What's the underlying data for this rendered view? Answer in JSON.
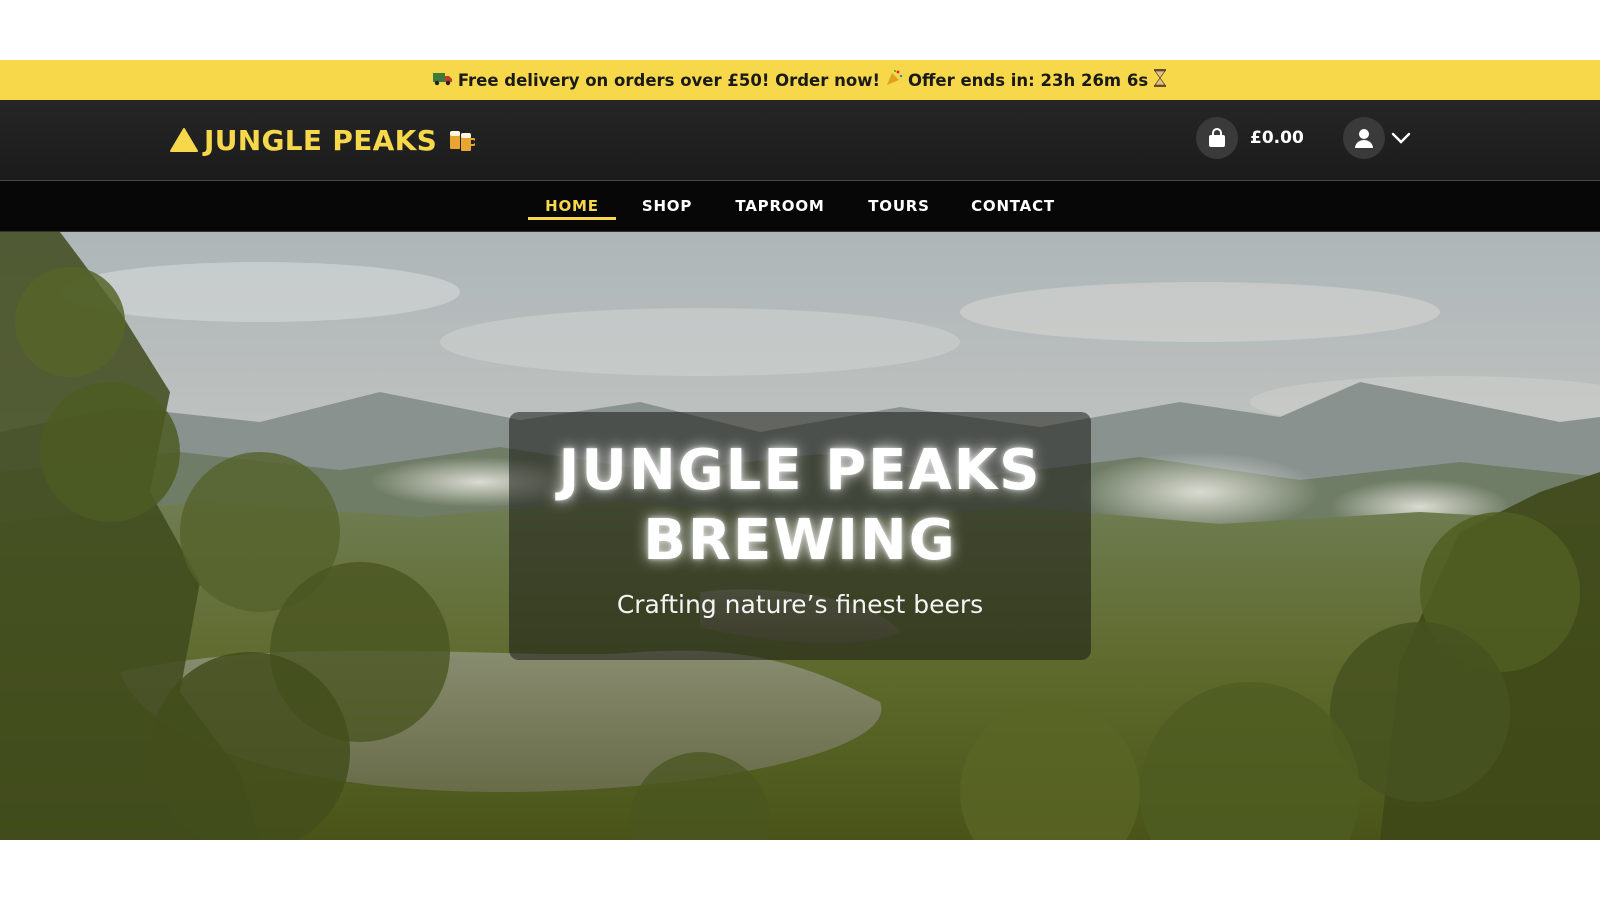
{
  "promo": {
    "icon_truck": "truck-emoji-icon",
    "text_main": "Free delivery on orders over £50! Order now!",
    "icon_party": "party-popper-icon",
    "text_offer": "Offer ends in: 23h 26m 6s",
    "icon_hourglass": "hourglass-icon"
  },
  "header": {
    "logo_text": "JUNGLE PEAKS",
    "logo_icons": [
      "warning-triangle-icon",
      "beer-mugs-icon"
    ],
    "cart_total": "£0.00",
    "cart_icon": "shopping-bag-icon",
    "account_icon": "user-icon"
  },
  "nav": {
    "items": [
      {
        "label": "HOME",
        "active": true
      },
      {
        "label": "SHOP",
        "active": false
      },
      {
        "label": "TAPROOM",
        "active": false
      },
      {
        "label": "TOURS",
        "active": false
      },
      {
        "label": "CONTACT",
        "active": false
      }
    ]
  },
  "hero": {
    "title_line1": "JUNGLE PEAKS",
    "title_line2": "BREWING",
    "subtitle": "Crafting nature’s finest beers"
  },
  "colors": {
    "accent_yellow": "#f7d84a",
    "header_bg": "#222222",
    "nav_bg": "#070707"
  }
}
